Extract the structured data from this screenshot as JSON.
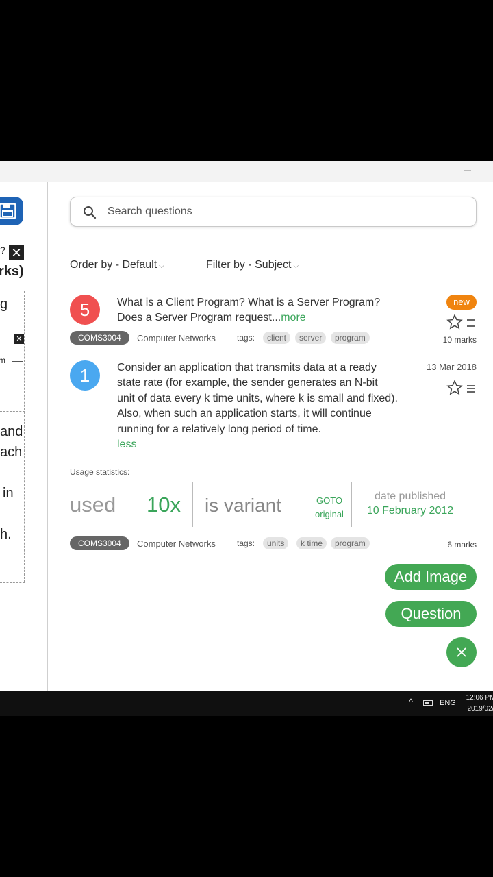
{
  "left_panel": {
    "fragments": [
      "?",
      "rks)",
      "g",
      "m",
      "and",
      "ach",
      "in",
      "h."
    ],
    "close_glyph": "✕"
  },
  "search": {
    "placeholder": "Search questions"
  },
  "filters": {
    "order_label": "Order by - Default",
    "filter_label": "Filter by - Subject",
    "chevron": "⌵"
  },
  "questions": [
    {
      "number": "5",
      "badge_color": "#f05050",
      "text": "What is a Client Program? What is a Server Program? Does a Server Program request...",
      "toggle": "more",
      "status_badge": "new",
      "marks": "10 marks",
      "course": "COMS3004",
      "subject": "Computer Networks",
      "tags_label": "tags:",
      "tags": [
        "client",
        "server",
        "program"
      ]
    },
    {
      "number": "1",
      "badge_color": "#4aa8f0",
      "date": "13 Mar 2018",
      "text": "Consider an application that transmits data at a ready state rate (for example, the sender generates an N-bit unit of data every k time units, where k is small and fixed). Also, when such an application starts, it will continue running for a relatively long period of time.",
      "toggle": "less",
      "usage": {
        "label": "Usage statistics:",
        "used_word": "used",
        "used_count": "10x",
        "variant_text": "is variant",
        "goto_line1": "GOTO",
        "goto_line2": "original",
        "date_label": "date published",
        "date_value": "10 February 2012"
      },
      "marks": "6 marks",
      "course": "COMS3004",
      "subject": "Computer Networks",
      "tags_label": "tags:",
      "tags": [
        "units",
        "k time",
        "program"
      ]
    }
  ],
  "actions": {
    "add_image": "Add Image",
    "question": "Question"
  },
  "taskbar": {
    "chevron": "^",
    "language": "ENG",
    "time": "12:06 PM",
    "date": "2019/02/"
  },
  "colors": {
    "accent_green": "#43a854",
    "new_orange": "#f0840f",
    "save_blue": "#1e63b5"
  }
}
